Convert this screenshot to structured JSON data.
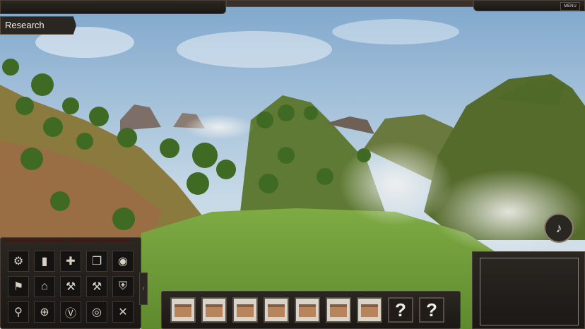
{
  "top_bar": {
    "menu_label": "MENU"
  },
  "research_tab": {
    "label": "Research"
  },
  "tools": [
    {
      "name": "settings-icon",
      "glyph": "⚙"
    },
    {
      "name": "book-icon",
      "glyph": "▮"
    },
    {
      "name": "map-icon",
      "glyph": "✚"
    },
    {
      "name": "open-book-icon",
      "glyph": "❐"
    },
    {
      "name": "chat-icon",
      "glyph": "◉"
    },
    {
      "name": "flag-icon",
      "glyph": "⚑"
    },
    {
      "name": "temple-icon",
      "glyph": "⌂"
    },
    {
      "name": "hammer-icon",
      "glyph": "⚒"
    },
    {
      "name": "hammer-add-icon",
      "glyph": "⚒"
    },
    {
      "name": "shield-icon",
      "glyph": "⛨"
    },
    {
      "name": "magnifier-icon",
      "glyph": "⚲"
    },
    {
      "name": "compass-icon",
      "glyph": "⊕"
    },
    {
      "name": "laurel-icon",
      "glyph": "Ⓥ"
    },
    {
      "name": "coins-icon",
      "glyph": "◎"
    },
    {
      "name": "crossed-tools-icon",
      "glyph": "✕"
    }
  ],
  "build_bar": {
    "slots": [
      {
        "name": "building-slot-1",
        "question": ""
      },
      {
        "name": "building-slot-2",
        "question": ""
      },
      {
        "name": "building-slot-3",
        "question": ""
      },
      {
        "name": "building-slot-4",
        "question": ""
      },
      {
        "name": "building-slot-5",
        "question": ""
      },
      {
        "name": "building-slot-6",
        "question": ""
      },
      {
        "name": "building-slot-7",
        "question": ""
      },
      {
        "name": "locked-slot-1",
        "question": "?"
      },
      {
        "name": "locked-slot-2",
        "question": "?"
      }
    ]
  },
  "colors": {
    "sky": "#8fb4d4",
    "grass": "#6e9a3a",
    "panel": "#1f1b18",
    "panel_border": "#4a4038"
  }
}
